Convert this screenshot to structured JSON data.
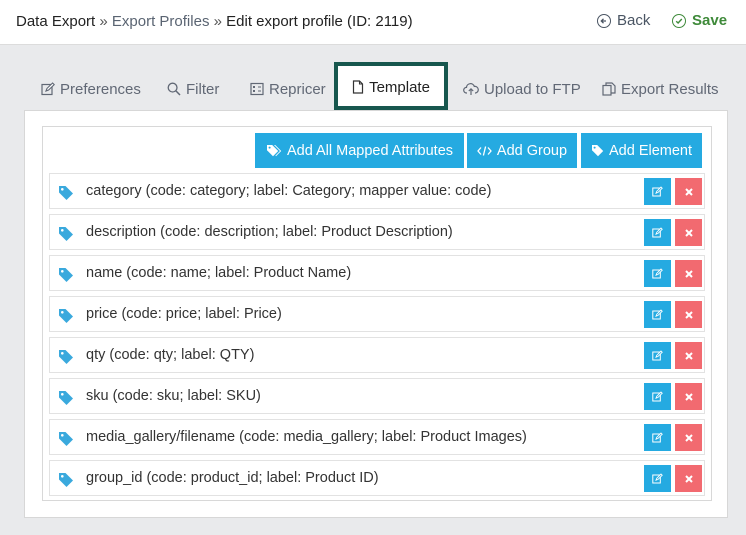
{
  "header": {
    "breadcrumb": {
      "root": "Data Export",
      "sep1": "»",
      "profiles": "Export Profiles",
      "sep2": "»",
      "current": "Edit export profile (ID: 2119)"
    },
    "back_label": "Back",
    "save_label": "Save",
    "colors": {
      "save": "#3f8a3a",
      "back": "#4a5563"
    }
  },
  "tabs": [
    {
      "label": "Preferences",
      "icon": "edit-icon"
    },
    {
      "label": "Filter",
      "icon": "search-icon"
    },
    {
      "label": "Repricer",
      "icon": "calculator-icon"
    },
    {
      "label": "Template",
      "icon": "file-icon",
      "active": true
    },
    {
      "label": "Upload to FTP",
      "icon": "cloud-upload-icon"
    },
    {
      "label": "Export Results",
      "icon": "copy-icon"
    }
  ],
  "toolbar": {
    "add_all_label": "Add All Mapped Attributes",
    "add_group_label": "Add Group",
    "add_element_label": "Add Element",
    "button_color": "#25aae1"
  },
  "elements": [
    {
      "label": "category (code: category; label: Category; mapper value: code)"
    },
    {
      "label": "description (code: description; label: Product Description)"
    },
    {
      "label": "name (code: name; label: Product Name)"
    },
    {
      "label": "price (code: price; label: Price)"
    },
    {
      "label": "qty (code: qty; label: QTY)"
    },
    {
      "label": "sku (code: sku; label: SKU)"
    },
    {
      "label": "media_gallery/filename (code: media_gallery; label: Product Images)"
    },
    {
      "label": "group_id (code: product_id; label: Product ID)"
    }
  ],
  "colors": {
    "edit": "#25aae1",
    "delete": "#f26a70",
    "tag": "#3aa9dd",
    "active_tab_border": "#17574e"
  }
}
